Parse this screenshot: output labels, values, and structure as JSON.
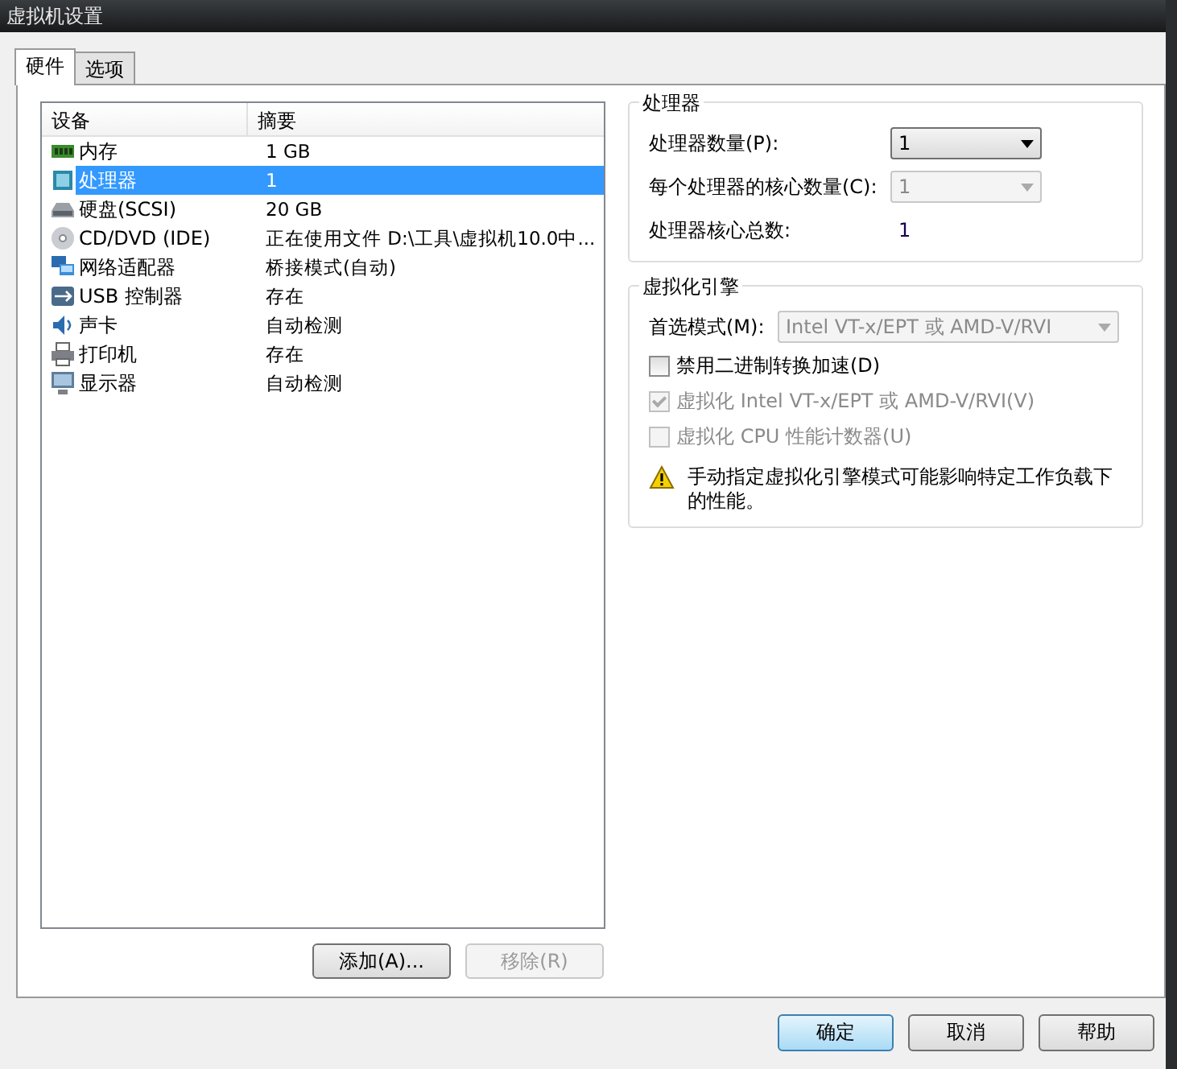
{
  "window": {
    "title": "虚拟机设置"
  },
  "tabs": [
    {
      "label": "硬件",
      "selected": true
    },
    {
      "label": "选项",
      "selected": false
    }
  ],
  "devices": {
    "columns": [
      "设备",
      "摘要"
    ],
    "rows": [
      {
        "kind": "memory",
        "device": "内存",
        "summary": "1 GB",
        "selected": false
      },
      {
        "kind": "cpu",
        "device": "处理器",
        "summary": "1",
        "selected": true
      },
      {
        "kind": "disk",
        "device": "硬盘(SCSI)",
        "summary": "20 GB",
        "selected": false
      },
      {
        "kind": "cd",
        "device": "CD/DVD (IDE)",
        "summary": "正在使用文件 D:\\工具\\虚拟机10.0中...",
        "selected": false
      },
      {
        "kind": "network",
        "device": "网络适配器",
        "summary": "桥接模式(自动)",
        "selected": false
      },
      {
        "kind": "usb",
        "device": "USB 控制器",
        "summary": "存在",
        "selected": false
      },
      {
        "kind": "sound",
        "device": "声卡",
        "summary": "自动检测",
        "selected": false
      },
      {
        "kind": "printer",
        "device": "打印机",
        "summary": "存在",
        "selected": false
      },
      {
        "kind": "display",
        "device": "显示器",
        "summary": "自动检测",
        "selected": false
      }
    ],
    "buttons": [
      {
        "label": "添加(A)...",
        "disabled": false
      },
      {
        "label": "移除(R)",
        "disabled": true
      }
    ]
  },
  "processor": {
    "title": "处理器",
    "fields": [
      {
        "kind": "dropdown",
        "label": "处理器数量(P):",
        "value": "1",
        "disabled": false
      },
      {
        "kind": "dropdown",
        "label": "每个处理器的核心数量(C):",
        "value": "1",
        "disabled": true
      },
      {
        "kind": "readout",
        "label": "处理器核心总数:",
        "value": "1"
      }
    ]
  },
  "virtualization": {
    "title": "虚拟化引擎",
    "mode": {
      "label": "首选模式(M):",
      "value": "Intel VT-x/EPT 或 AMD-V/RVI",
      "disabled": true
    },
    "options": [
      {
        "label": "禁用二进制转换加速(D)",
        "checked": false,
        "disabled": false
      },
      {
        "label": "虚拟化 Intel VT-x/EPT 或 AMD-V/RVI(V)",
        "checked": true,
        "disabled": true
      },
      {
        "label": "虚拟化 CPU 性能计数器(U)",
        "checked": false,
        "disabled": true
      }
    ],
    "warning": "手动指定虚拟化引擎模式可能影响特定工作负载下的性能。"
  },
  "dialog_buttons": [
    {
      "label": "确定",
      "selected": true
    },
    {
      "label": "取消",
      "selected": false
    },
    {
      "label": "帮助",
      "selected": false
    }
  ]
}
